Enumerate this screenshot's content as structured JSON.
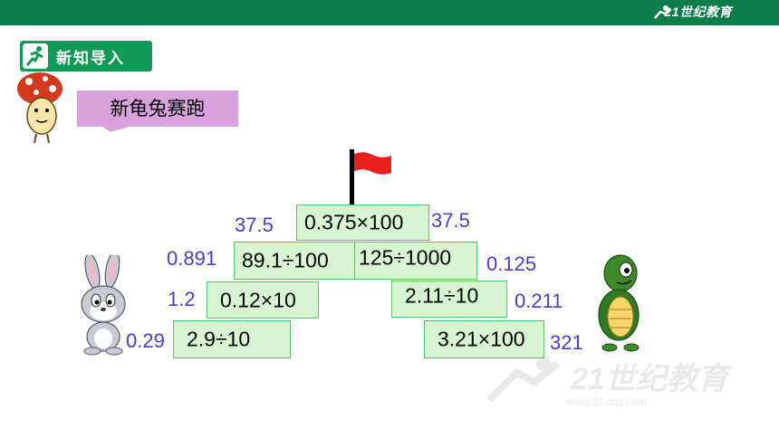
{
  "header": {
    "brand": "21世纪教育",
    "bar_color": "#0b7c4a"
  },
  "section": {
    "label": "新知导入",
    "icon": "runner-icon",
    "color": "#119a55"
  },
  "title": {
    "text": "新龟兔赛跑",
    "color": "#d8a3dc"
  },
  "flag": {
    "icon": "red-flag-icon"
  },
  "expressions": [
    {
      "expr": "0.375×100",
      "answer_left": "37.5",
      "answer_right": "37.5"
    },
    {
      "expr": "89.1÷100",
      "answer": "0.891"
    },
    {
      "expr": "125÷1000",
      "answer": "0.125"
    },
    {
      "expr": "0.12×10",
      "answer": "1.2"
    },
    {
      "expr": "2.11÷10",
      "answer": "0.211"
    },
    {
      "expr": "2.9÷10",
      "answer": "0.29"
    },
    {
      "expr": "3.21×100",
      "answer": "321"
    }
  ],
  "characters": {
    "rabbit": "rabbit-illustration",
    "turtle": "turtle-illustration",
    "mascot": "mushroom-mascot"
  },
  "colors": {
    "box_fill": "#d6f5d0",
    "box_border": "#5fc05f",
    "answer_text": "#4a3ccf"
  }
}
